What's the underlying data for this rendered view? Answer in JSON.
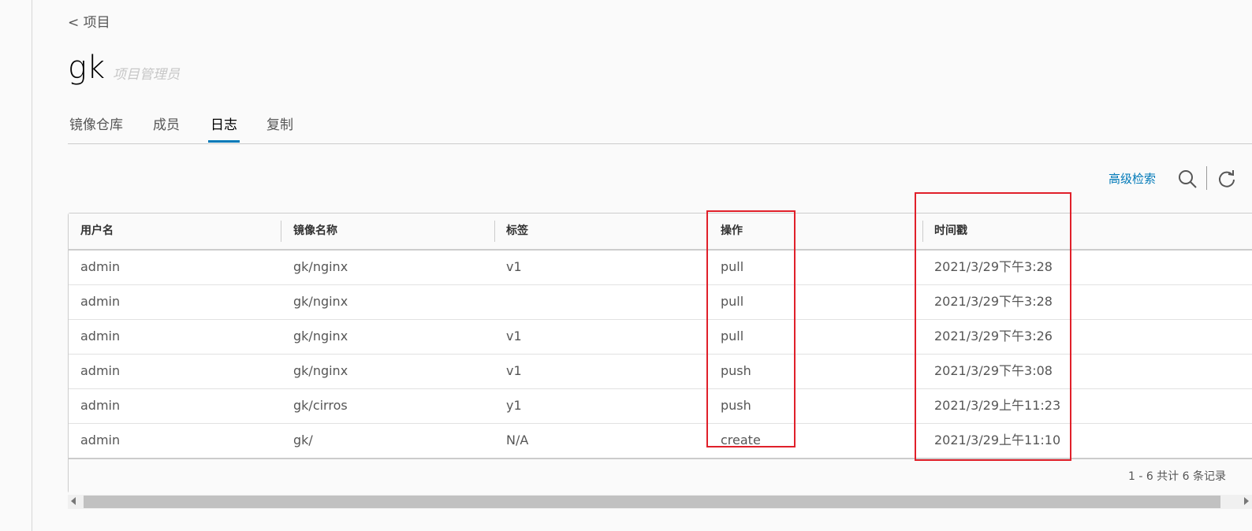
{
  "back_link": "< 项目",
  "project": {
    "name": "gk",
    "role": "项目管理员"
  },
  "tabs": [
    {
      "label": "镜像仓库",
      "active": false
    },
    {
      "label": "成员",
      "active": false
    },
    {
      "label": "日志",
      "active": true
    },
    {
      "label": "复制",
      "active": false
    }
  ],
  "toolbar": {
    "advanced_search": "高级检索"
  },
  "table": {
    "columns": [
      "用户名",
      "镜像名称",
      "标签",
      "操作",
      "时间戳"
    ],
    "rows": [
      [
        "admin",
        "gk/nginx",
        "v1",
        "pull",
        "2021/3/29下午3:28"
      ],
      [
        "admin",
        "gk/nginx",
        "",
        "pull",
        "2021/3/29下午3:28"
      ],
      [
        "admin",
        "gk/nginx",
        "v1",
        "pull",
        "2021/3/29下午3:26"
      ],
      [
        "admin",
        "gk/nginx",
        "v1",
        "push",
        "2021/3/29下午3:08"
      ],
      [
        "admin",
        "gk/cirros",
        "y1",
        "push",
        "2021/3/29上午11:23"
      ],
      [
        "admin",
        "gk/",
        "N/A",
        "create",
        "2021/3/29上午11:10"
      ]
    ],
    "footer": "1 - 6 共计 6 条记录"
  },
  "colors": {
    "accent": "#0079b8",
    "highlight": "#e0202a"
  }
}
